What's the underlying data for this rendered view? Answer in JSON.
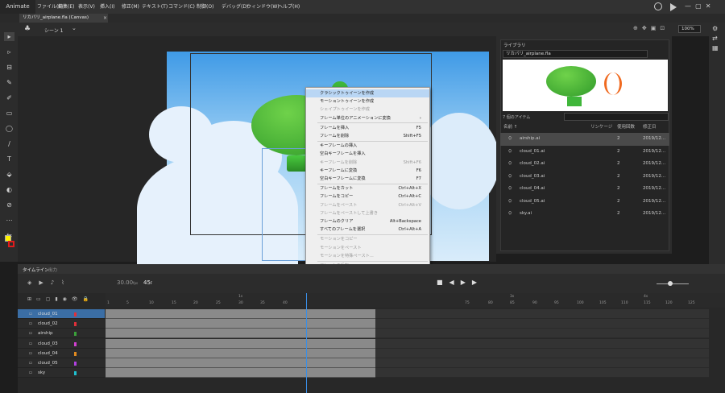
{
  "app": {
    "name": "Animate"
  },
  "menu": [
    "ファイル(F)",
    "編集(E)",
    "表示(V)",
    "挿入(I)",
    "修正(M)",
    "テキスト(T)",
    "コマンド(C)",
    "制御(O)",
    "デバッグ(D)",
    "ウィンドウ(W)",
    "ヘルプ(H)"
  ],
  "doc_tab": "リカバリ_airplane.fla (Canvas)",
  "scene": "シーン 1",
  "zoom": "100%",
  "library": {
    "title": "ライブラリ",
    "file": "リカバリ_airplane.fla",
    "count": "7 個のアイテム",
    "cols": [
      "名前 ↑",
      "リンケージ",
      "使用回数",
      "修正日"
    ],
    "items": [
      {
        "name": "airship.ai",
        "uses": "2",
        "date": "2019/12..."
      },
      {
        "name": "cloud_01.ai",
        "uses": "2",
        "date": "2019/12..."
      },
      {
        "name": "cloud_02.ai",
        "uses": "2",
        "date": "2019/12..."
      },
      {
        "name": "cloud_03.ai",
        "uses": "2",
        "date": "2019/12..."
      },
      {
        "name": "cloud_04.ai",
        "uses": "2",
        "date": "2019/12..."
      },
      {
        "name": "cloud_05.ai",
        "uses": "2",
        "date": "2019/12..."
      },
      {
        "name": "sky.ai",
        "uses": "2",
        "date": "2019/12..."
      }
    ]
  },
  "context_menu": [
    {
      "label": "クラシックトゥイーンを作成",
      "sc": "",
      "st": "hl"
    },
    {
      "label": "モーショントゥイーンを作成",
      "sc": "",
      "st": ""
    },
    {
      "label": "シェイプトゥイーンを作成",
      "sc": "",
      "st": "dis"
    },
    {
      "label": "フレーム単位のアニメーションに変換",
      "sc": "›",
      "st": "sep"
    },
    {
      "label": "フレームを挿入",
      "sc": "F5",
      "st": ""
    },
    {
      "label": "フレームを削除",
      "sc": "Shift+F5",
      "st": "sep"
    },
    {
      "label": "キーフレームの挿入",
      "sc": "",
      "st": ""
    },
    {
      "label": "空白キーフレームを挿入",
      "sc": "",
      "st": ""
    },
    {
      "label": "キーフレームを削除",
      "sc": "Shift+F6",
      "st": "dis"
    },
    {
      "label": "キーフレームに変換",
      "sc": "F6",
      "st": ""
    },
    {
      "label": "空白キーフレームに変換",
      "sc": "F7",
      "st": "sep"
    },
    {
      "label": "フレームをカット",
      "sc": "Ctrl+Alt+X",
      "st": ""
    },
    {
      "label": "フレームをコピー",
      "sc": "Ctrl+Alt+C",
      "st": ""
    },
    {
      "label": "フレームをペースト",
      "sc": "Ctrl+Alt+V",
      "st": "dis"
    },
    {
      "label": "フレームをペーストして上書き",
      "sc": "",
      "st": "dis"
    },
    {
      "label": "フレームのクリア",
      "sc": "Alt+Backspace",
      "st": ""
    },
    {
      "label": "すべてのフレームを選択",
      "sc": "Ctrl+Alt+A",
      "st": "sep"
    },
    {
      "label": "モーションをコピー",
      "sc": "",
      "st": "dis"
    },
    {
      "label": "モーションをペースト",
      "sc": "",
      "st": "dis"
    },
    {
      "label": "モーションを特殊ペースト...",
      "sc": "",
      "st": "dis sep"
    },
    {
      "label": "フレームの反転",
      "sc": "",
      "st": "dis"
    },
    {
      "label": "シンボルの同期",
      "sc": "",
      "st": "dis"
    },
    {
      "label": "オーディオを分割",
      "sc": "",
      "st": "dis"
    },
    {
      "label": "ライブラリに表示",
      "sc": "",
      "st": "dis sep"
    },
    {
      "label": "アクション",
      "sc": "F9",
      "st": ""
    }
  ],
  "timeline": {
    "tab": "タイムライン",
    "tab2": "出力",
    "fps": "30.00",
    "fps_unit": "fps",
    "frame": "45",
    "frame_unit": "F",
    "ruler": [
      "1",
      "5",
      "10",
      "15",
      "20",
      "25",
      "30",
      "35",
      "40",
      "75",
      "80",
      "85",
      "90",
      "95",
      "100",
      "105",
      "110",
      "115",
      "120",
      "125"
    ],
    "marks": [
      "1s",
      "3s",
      "4s"
    ],
    "layers": [
      {
        "name": "cloud_01",
        "color": "#e0303a"
      },
      {
        "name": "cloud_02",
        "color": "#e0303a"
      },
      {
        "name": "airship",
        "color": "#3aa13a"
      },
      {
        "name": "cloud_03",
        "color": "#d040d0"
      },
      {
        "name": "cloud_04",
        "color": "#e08a20"
      },
      {
        "name": "cloud_05",
        "color": "#b040e0"
      },
      {
        "name": "sky",
        "color": "#20c0d0"
      }
    ]
  }
}
